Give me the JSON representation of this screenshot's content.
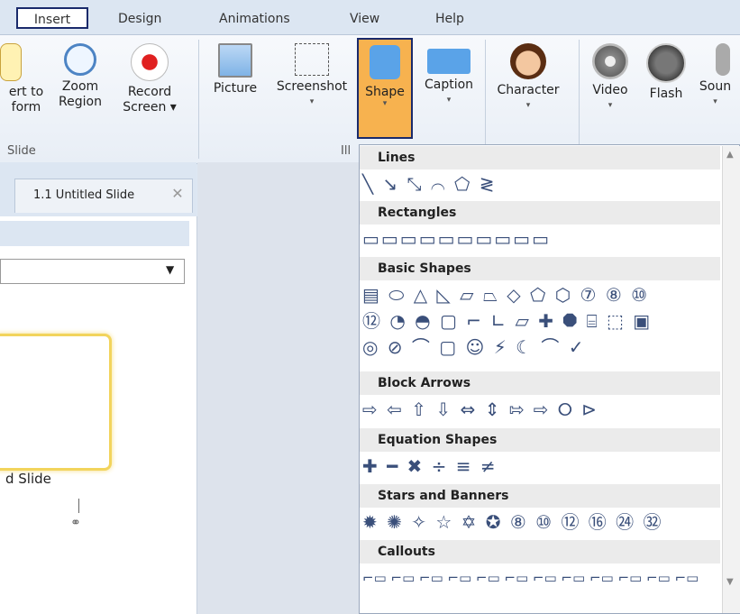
{
  "tabs": [
    "Insert",
    "Design",
    "Animations",
    "View",
    "Help"
  ],
  "ribbon": {
    "buttons": [
      {
        "line1": "ert to",
        "line2": "form",
        "caret": ""
      },
      {
        "line1": "Zoom",
        "line2": "Region",
        "caret": ""
      },
      {
        "line1": "Record",
        "line2": "Screen",
        "caret": "▾"
      },
      {
        "line1": "Picture",
        "line2": "",
        "caret": ""
      },
      {
        "line1": "Screenshot",
        "line2": "",
        "caret": "▾"
      },
      {
        "line1": "Shape",
        "line2": "",
        "caret": "▾"
      },
      {
        "line1": "Caption",
        "line2": "",
        "caret": "▾"
      },
      {
        "line1": "Character",
        "line2": "",
        "caret": "▾"
      },
      {
        "line1": "Video",
        "line2": "",
        "caret": "▾"
      },
      {
        "line1": "Flash",
        "line2": "",
        "caret": ""
      },
      {
        "line1": "Soun",
        "line2": "",
        "caret": "▾"
      }
    ],
    "group_slide": "Slide",
    "group_ill": "Ill"
  },
  "doc_tab": {
    "label": "1.1 Untitled Slide",
    "close": "✕"
  },
  "left": {
    "dropdown_arrow": "▼",
    "thumb_label": "d Slide",
    "link_icon": "⚭"
  },
  "menu": {
    "categories": [
      "Lines",
      "Rectangles",
      "Basic Shapes",
      "Block Arrows",
      "Equation Shapes",
      "Stars and Banners",
      "Callouts"
    ],
    "rows": {
      "lines": "╲ ↘ ⤡ ⌒ ⬠ ≷",
      "rectangles": "▭▭▭▭▭▭▭▭▭▭",
      "basic1": "▤ ⬭ △ ◺ ▱ ⏢ ◇ ⬠ ⬡ ⑦ ⑧ ⑩",
      "basic2": "⑫ ◔ ◓ ▢ ⌐ ∟ ▱ ✚ ⯃ ⌸ ⬚ ▣",
      "basic3": "◎ ⊘ ⌒ ▢ ☺ ⚡ ☾ ⌒ ✓",
      "arrows": "⇨ ⇦ ⇧ ⇩ ⇔ ⇕ ⇰ ⇨ ⭘ ⊳",
      "equation": "✚ ━ ✖ ÷ ≡ ≠",
      "stars": "✹ ✺ ✧ ☆ ✡ ✪ ⑧ ⑩ ⑫ ⑯ ㉔ ㉜",
      "callouts": "⌐▭ ⌐▭ ⌐▭ ⌐▭ ⌐▭ ⌐▭ ⌐▭ ⌐▭ ⌐▭ ⌐▭ ⌐▭ ⌐▭"
    },
    "scroll_up": "▲",
    "scroll_down": "▼"
  }
}
